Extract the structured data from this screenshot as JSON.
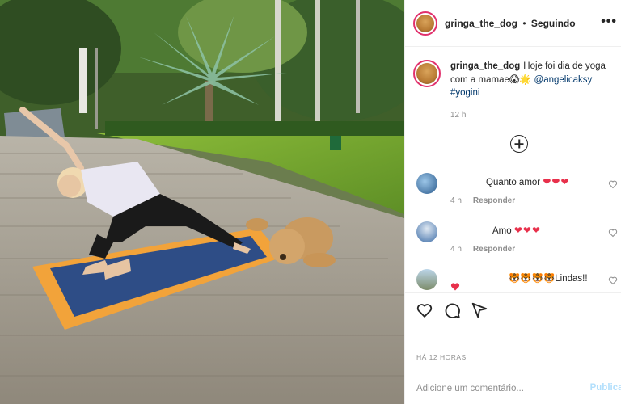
{
  "header": {
    "username": "gringa_the_dog",
    "separator": "•",
    "follow_status": "Seguindo",
    "more_icon": "more-horizontal-icon"
  },
  "caption": {
    "username": "gringa_the_dog",
    "text_part1": "Hoje foi dia de yoga com a mamae",
    "emojis": "😱🌟",
    "mention": "@angelicaksy",
    "hashtag": "#yogini",
    "time": "12 h"
  },
  "comments": [
    {
      "text": "Quanto amor",
      "hearts": "❤❤❤",
      "time": "4 h",
      "reply": "Responder"
    },
    {
      "text": "Amo",
      "hearts": "❤❤❤",
      "time": "4 h",
      "reply": "Responder"
    },
    {
      "text": "🐯🐯🐯🐯Lindas!!",
      "hearts": "",
      "time": "",
      "reply": ""
    }
  ],
  "posted": "HÁ 12 HORAS",
  "add_comment": {
    "placeholder": "Adicione um comentário...",
    "post_label": "Publicar"
  },
  "colors": {
    "link": "#00376b",
    "heart": "#e8304b",
    "muted": "#8e8e8e",
    "post_disabled": "#b2dffc"
  }
}
